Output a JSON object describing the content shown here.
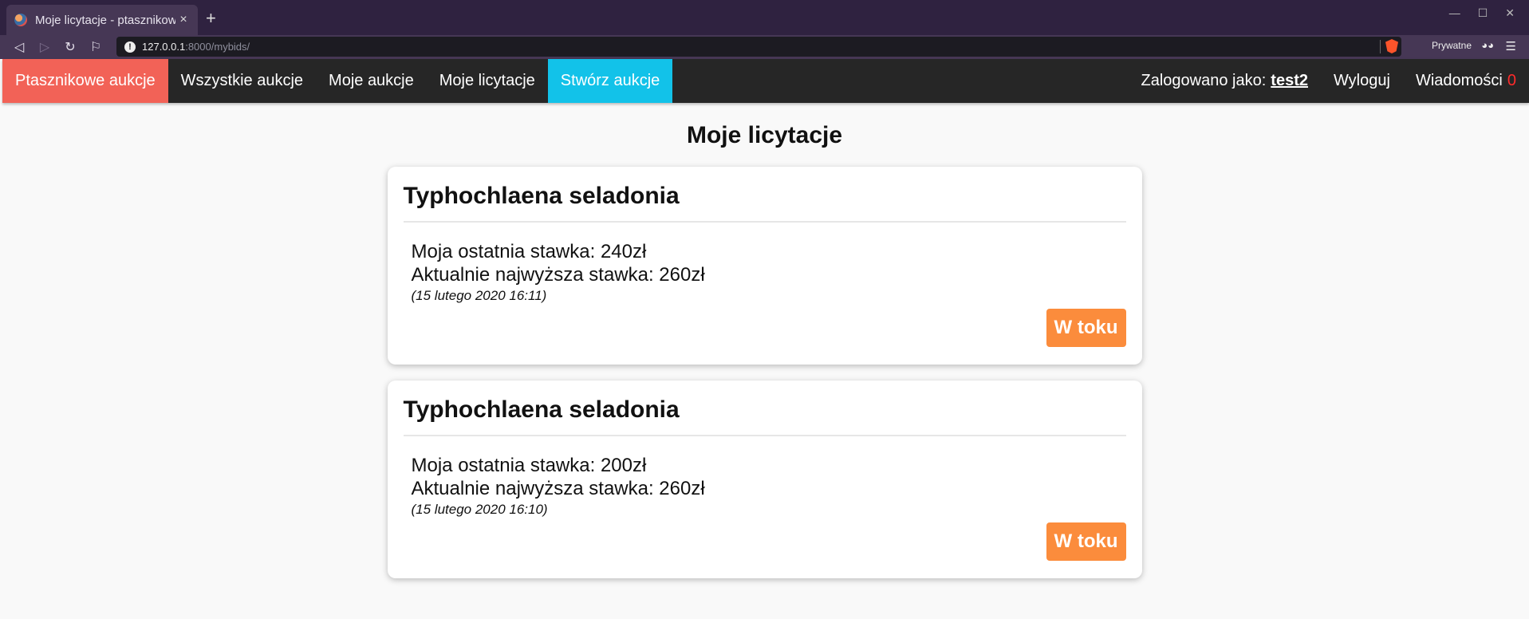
{
  "browser": {
    "tab_title": "Moje licytacje - ptasznikow",
    "tab_close": "×",
    "new_tab": "+",
    "url_host": "127.0.0.1",
    "url_rest": ":8000/mybids/",
    "private_label": "Prywatne",
    "icons": [
      "back-icon",
      "forward-icon",
      "reload-icon",
      "bookmark-icon",
      "info-icon",
      "brave-icon",
      "private-glasses-icon",
      "menu-icon"
    ]
  },
  "nav": {
    "brand": "Ptasznikowe aukcje",
    "all_auctions": "Wszystkie aukcje",
    "my_auctions": "Moje aukcje",
    "my_bids": "Moje licytacje",
    "create_auction": "Stwórz aukcje",
    "logged_as": "Zalogowano jako:",
    "username": "test2",
    "logout": "Wyloguj",
    "messages": "Wiadomości",
    "messages_count": "0",
    "colors": {
      "brand": "#f26257",
      "create": "#12c2e9",
      "bar": "#262626"
    }
  },
  "page": {
    "title": "Moje licytacje"
  },
  "bids": [
    {
      "title": "Typhochlaena seladonia",
      "my_bid": "Moja ostatnia stawka: 240zł",
      "highest_bid": "Aktualnie najwyższa stawka: 260zł",
      "date": "(15 lutego 2020 16:11)",
      "status": "W toku"
    },
    {
      "title": "Typhochlaena seladonia",
      "my_bid": "Moja ostatnia stawka: 200zł",
      "highest_bid": "Aktualnie najwyższa stawka: 260zł",
      "date": "(15 lutego 2020 16:10)",
      "status": "W toku"
    }
  ]
}
